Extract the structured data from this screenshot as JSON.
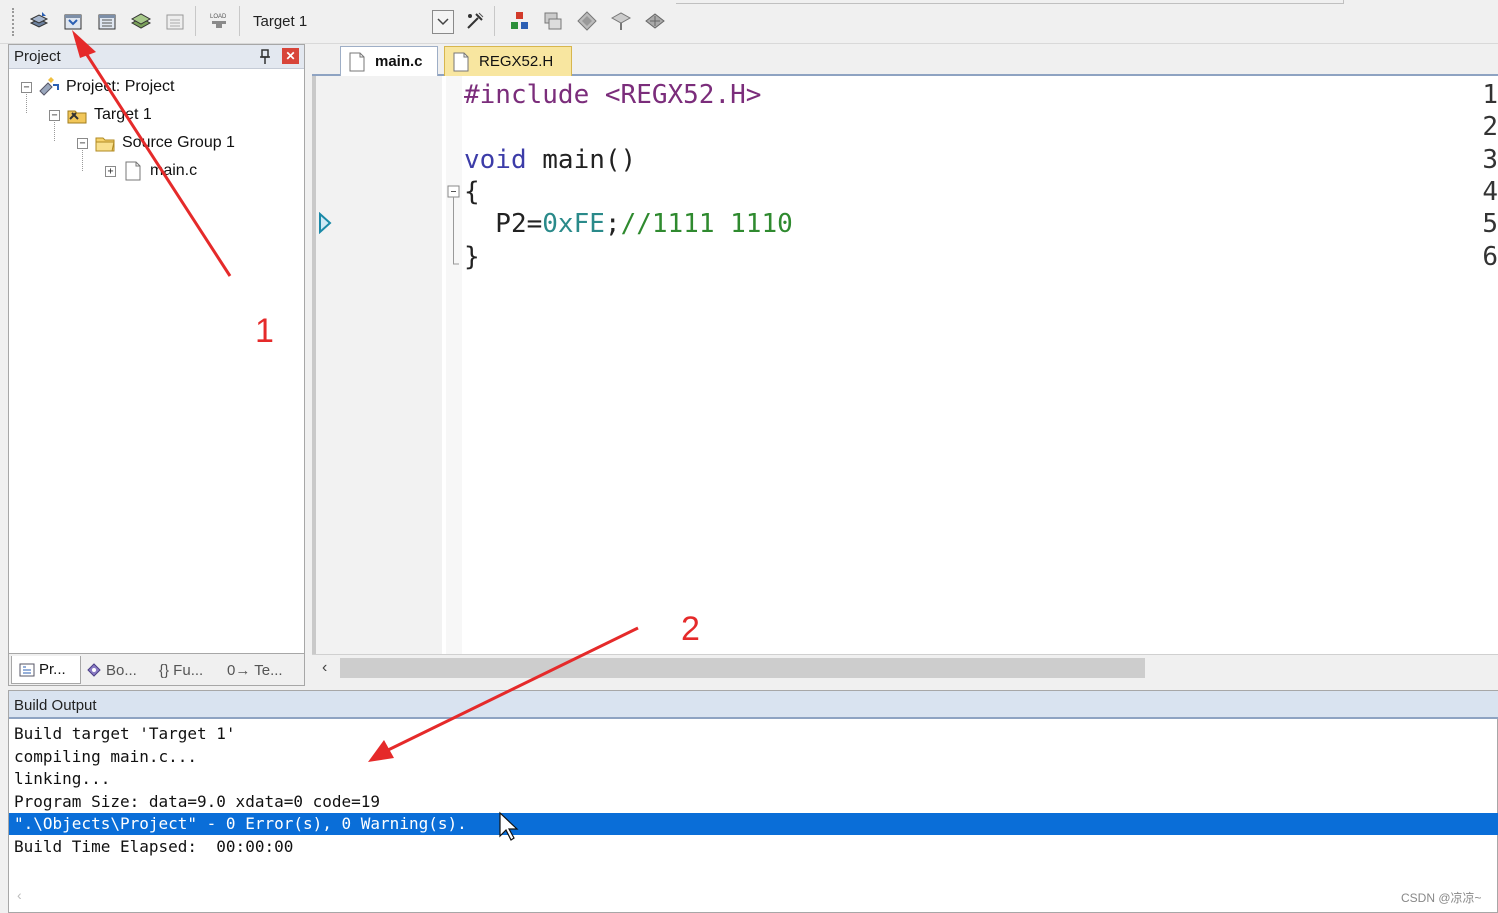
{
  "toolbar": {
    "target_combo_value": "Target 1",
    "buttons_left": [
      "translate-icon",
      "build-icon",
      "rebuild-icon",
      "batch-build-icon",
      "stop-build-icon",
      "download-icon"
    ],
    "buttons_right": [
      "target-options-icon",
      "manage-components-icon",
      "select-packs-icon",
      "pack-installer-icon",
      "manage-run-time-icon",
      "event-recorder-icon"
    ]
  },
  "project_panel": {
    "title": "Project",
    "tree": [
      {
        "label": "Project: Project",
        "level": 0,
        "expander": "−",
        "icon": "project-icon"
      },
      {
        "label": "Target 1",
        "level": 1,
        "expander": "−",
        "icon": "target-icon"
      },
      {
        "label": "Source Group 1",
        "level": 2,
        "expander": "−",
        "icon": "folder-icon"
      },
      {
        "label": "main.c",
        "level": 3,
        "expander": "+",
        "icon": "file-icon"
      }
    ],
    "bottom_tabs": [
      "Pr...",
      "Bo...",
      "{} Fu...",
      "0→ Te..."
    ]
  },
  "editor": {
    "tabs": [
      {
        "label": "main.c",
        "active": true
      },
      {
        "label": "REGX52.H",
        "active": false
      }
    ],
    "lines": [
      {
        "num": "1",
        "tokens": [
          {
            "t": "#include ",
            "c": "c-str"
          },
          {
            "t": "<REGX52.H>",
            "c": "c-str"
          }
        ]
      },
      {
        "num": "2",
        "tokens": []
      },
      {
        "num": "3",
        "tokens": [
          {
            "t": "void",
            "c": "c-kw"
          },
          {
            "t": " main()",
            "c": "c-plain"
          }
        ]
      },
      {
        "num": "4",
        "tokens": [
          {
            "t": "{",
            "c": "c-plain"
          }
        ]
      },
      {
        "num": "5",
        "tokens": [
          {
            "t": "  P2=",
            "c": "c-plain"
          },
          {
            "t": "0xFE",
            "c": "c-num"
          },
          {
            "t": ";",
            "c": "c-plain"
          },
          {
            "t": "//1111 1110",
            "c": "c-cmt"
          }
        ]
      },
      {
        "num": "6",
        "tokens": [
          {
            "t": "}",
            "c": "c-plain"
          }
        ]
      }
    ]
  },
  "build_output": {
    "title": "Build Output",
    "lines": [
      "Build target 'Target 1'",
      "compiling main.c...",
      "linking...",
      "Program Size: data=9.0 xdata=0 code=19",
      "\".\\Objects\\Project\" - 0 Error(s), 0 Warning(s).",
      "Build Time Elapsed:  00:00:00"
    ],
    "highlighted_index": 4
  },
  "annotations": {
    "label_1": "1",
    "label_2": "2",
    "arrow_color": "#e52a2a"
  },
  "watermark": "CSDN @凉凉~",
  "colors": {
    "accent_blue": "#0a6ed8",
    "tab_yellow": "#f8e6a0",
    "panel_title": "#d9e3f0"
  }
}
